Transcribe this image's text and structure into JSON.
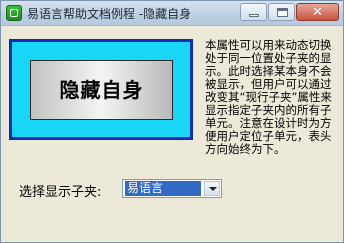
{
  "window": {
    "title": "易语言帮助文档例程 -隐藏自身"
  },
  "titlebar": {
    "app_icon": "app-icon",
    "minimize_icon": "minimize-icon",
    "maximize_icon": "maximize-icon",
    "close_icon": "close-icon",
    "close_glyph": "✕"
  },
  "panel": {
    "label": "隐藏自身",
    "border_color": "#0a2fb5",
    "fill_color": "#18d6f6"
  },
  "description": "本属性可以用来动态切换处于同一位置处子夹的显示。此时选择某本身不会被显示，但用户可以通过改变其“现行子夹”属性来显示指定子夹内的所有子单元。注意在设计时为方便用户定位子单元，表头方向始终为下。",
  "selector": {
    "label": "选择显示子夹:",
    "value": "易语言"
  }
}
